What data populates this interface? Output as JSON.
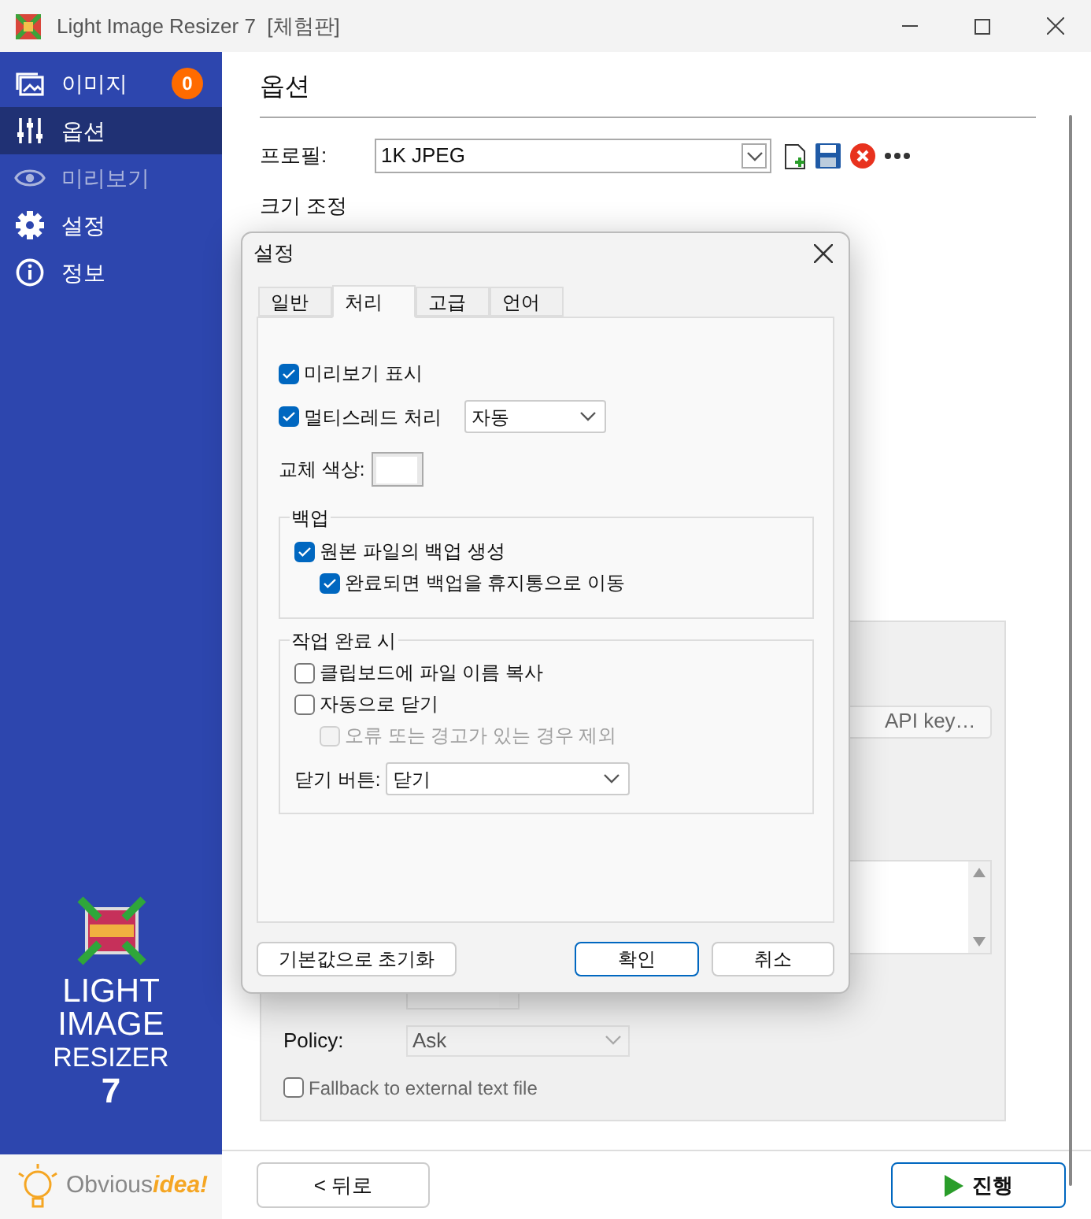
{
  "window": {
    "title": "Light Image Resizer 7  [체험판]"
  },
  "sidebar": {
    "items": [
      {
        "label": "이미지",
        "badge": "0",
        "selected": false,
        "disabled": false
      },
      {
        "label": "옵션",
        "selected": true,
        "disabled": false
      },
      {
        "label": "미리보기",
        "selected": false,
        "disabled": true
      },
      {
        "label": "설정",
        "selected": false,
        "disabled": false
      },
      {
        "label": "정보",
        "selected": false,
        "disabled": false
      }
    ],
    "logo_lines": [
      "LIGHT",
      "IMAGE",
      "RESIZER",
      "7"
    ],
    "brand": {
      "part_1": "Obvious",
      "part_2": "idea!"
    }
  },
  "main": {
    "heading": "옵션",
    "profile": {
      "label": "프로필:",
      "value": "1K JPEG"
    },
    "section": "크기 조정",
    "api_key_button": "API key…",
    "policy": {
      "label": "Policy:",
      "value": "Ask"
    },
    "fallback": {
      "label": "Fallback to external text file",
      "checked": false
    }
  },
  "dialog": {
    "title": "설정",
    "tabs": [
      {
        "label": "일반",
        "selected": false
      },
      {
        "label": "처리",
        "selected": true
      },
      {
        "label": "고급",
        "selected": false
      },
      {
        "label": "언어",
        "selected": false
      }
    ],
    "preview": {
      "label": "미리보기 표시",
      "checked": true
    },
    "multithread": {
      "label": "멀티스레드 처리",
      "checked": true,
      "value": "자동"
    },
    "replace_color": {
      "label": "교체 색상:",
      "color": "#ffffff"
    },
    "backup": {
      "title": "백업",
      "items": [
        {
          "label": "원본 파일의 백업 생성",
          "checked": true,
          "disabled": false,
          "children": [
            {
              "label": "완료되면 백업을 휴지통으로 이동",
              "checked": true,
              "disabled": false
            }
          ]
        }
      ]
    },
    "on_complete": {
      "title": "작업 완료 시",
      "items": [
        {
          "label": "클립보드에 파일 이름 복사",
          "checked": false,
          "disabled": false
        },
        {
          "label": "자동으로 닫기",
          "checked": false,
          "disabled": false,
          "children": [
            {
              "label": "오류 또는 경고가 있는 경우 제외",
              "checked": false,
              "disabled": true
            }
          ]
        }
      ],
      "close_button": {
        "label": "닫기 버튼:",
        "value": "닫기"
      }
    },
    "buttons": {
      "reset": "기본값으로 초기화",
      "ok": "확인",
      "cancel": "취소"
    }
  },
  "footer": {
    "back": "< 뒤로",
    "run": "진행"
  }
}
